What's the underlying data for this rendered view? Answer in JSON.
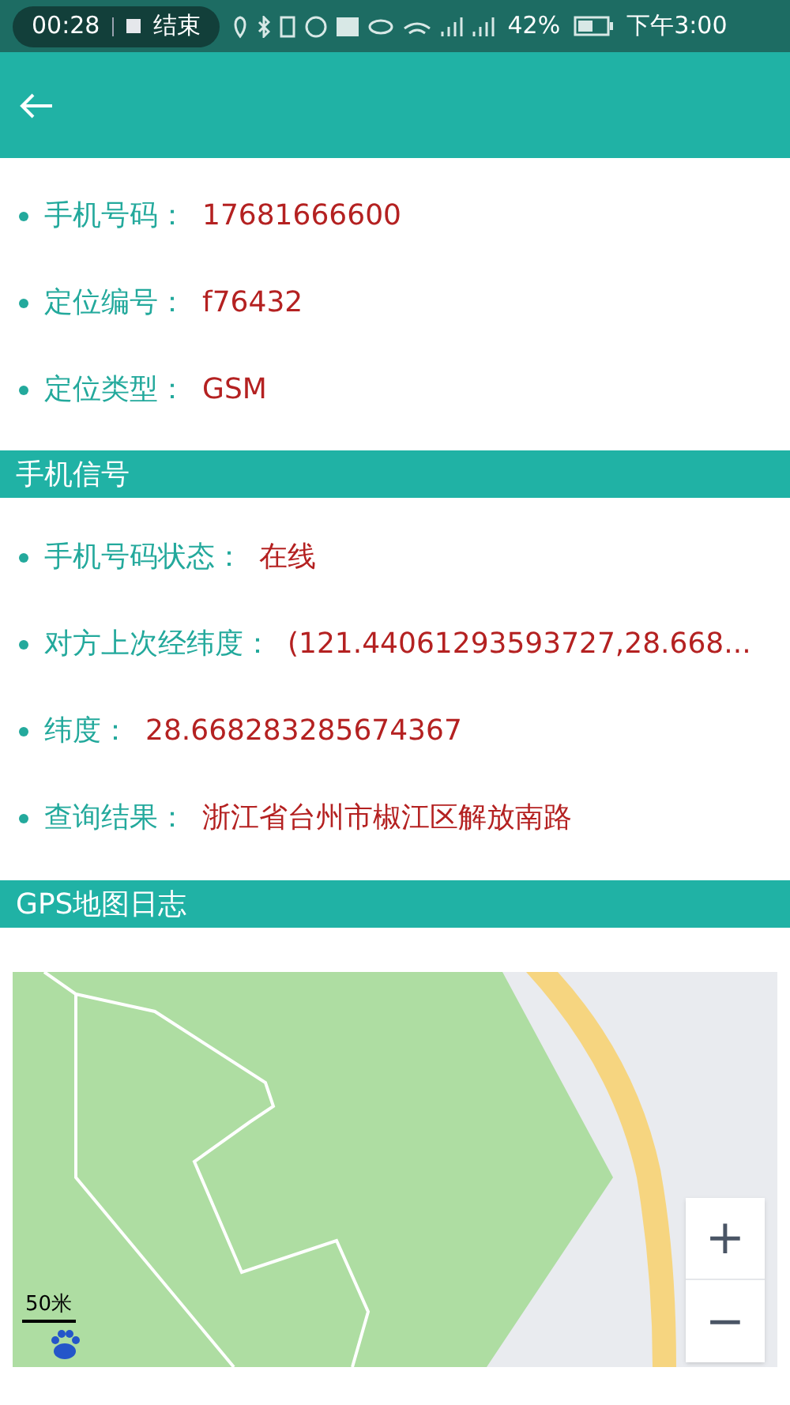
{
  "status_bar": {
    "call_time": "00:28",
    "end_call": "结束",
    "battery": "42%",
    "clock": "下午3:00"
  },
  "fields": [
    {
      "label": "手机号码：",
      "value": "17681666600"
    },
    {
      "label": "定位编号：",
      "value": "f76432"
    },
    {
      "label": "定位类型：",
      "value": "GSM"
    }
  ],
  "signal_section": {
    "title": "手机信号",
    "fields": [
      {
        "label": "手机号码状态：",
        "value": "在线"
      },
      {
        "label": "对方上次经纬度：",
        "value": "(121.44061293593727,28.668..."
      },
      {
        "label": "纬度：",
        "value": "28.668283285674367"
      },
      {
        "label": "查询结果：",
        "value": "浙江省台州市椒江区解放南路"
      }
    ]
  },
  "map_section": {
    "title": "GPS地图日志"
  },
  "map": {
    "zoom_in": "+",
    "zoom_out": "−",
    "scale": "50米"
  }
}
